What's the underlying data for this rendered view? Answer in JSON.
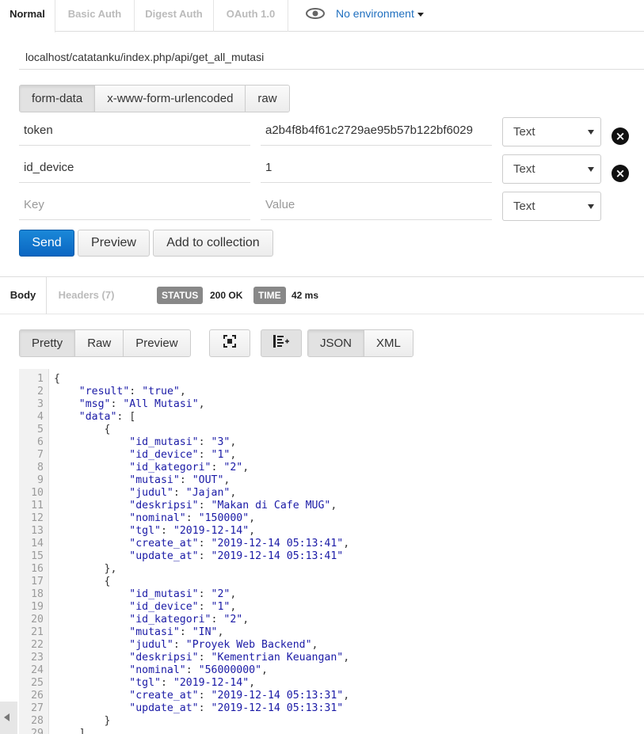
{
  "auth_tabs": [
    "Normal",
    "Basic Auth",
    "Digest Auth",
    "OAuth 1.0"
  ],
  "environment": {
    "label": "No environment"
  },
  "url": "localhost/catatanku/index.php/api/get_all_mutasi",
  "body_types": [
    "form-data",
    "x-www-form-urlencoded",
    "raw"
  ],
  "params": [
    {
      "key": "token",
      "value": "a2b4f8b4f61c2729ae95b57b122bf6029",
      "type": "Text"
    },
    {
      "key": "id_device",
      "value": "1",
      "type": "Text"
    }
  ],
  "new_param": {
    "key_placeholder": "Key",
    "value_placeholder": "Value",
    "type": "Text"
  },
  "actions": {
    "send": "Send",
    "preview": "Preview",
    "add_to_collection": "Add to collection"
  },
  "response": {
    "tabs": {
      "body": "Body",
      "headers": "Headers (7)"
    },
    "status_label": "STATUS",
    "status_value": "200 OK",
    "time_label": "TIME",
    "time_value": "42 ms",
    "view_modes": [
      "Pretty",
      "Raw",
      "Preview"
    ],
    "formats": [
      "JSON",
      "XML"
    ]
  },
  "code_lines": [
    "{",
    "    \"result\": \"true\",",
    "    \"msg\": \"All Mutasi\",",
    "    \"data\": [",
    "        {",
    "            \"id_mutasi\": \"3\",",
    "            \"id_device\": \"1\",",
    "            \"id_kategori\": \"2\",",
    "            \"mutasi\": \"OUT\",",
    "            \"judul\": \"Jajan\",",
    "            \"deskripsi\": \"Makan di Cafe MUG\",",
    "            \"nominal\": \"150000\",",
    "            \"tgl\": \"2019-12-14\",",
    "            \"create_at\": \"2019-12-14 05:13:41\",",
    "            \"update_at\": \"2019-12-14 05:13:41\"",
    "        },",
    "        {",
    "            \"id_mutasi\": \"2\",",
    "            \"id_device\": \"1\",",
    "            \"id_kategori\": \"2\",",
    "            \"mutasi\": \"IN\",",
    "            \"judul\": \"Proyek Web Backend\",",
    "            \"deskripsi\": \"Kementrian Keuangan\",",
    "            \"nominal\": \"56000000\",",
    "            \"tgl\": \"2019-12-14\",",
    "            \"create_at\": \"2019-12-14 05:13:31\",",
    "            \"update_at\": \"2019-12-14 05:13:31\"",
    "        }",
    "    ]"
  ]
}
